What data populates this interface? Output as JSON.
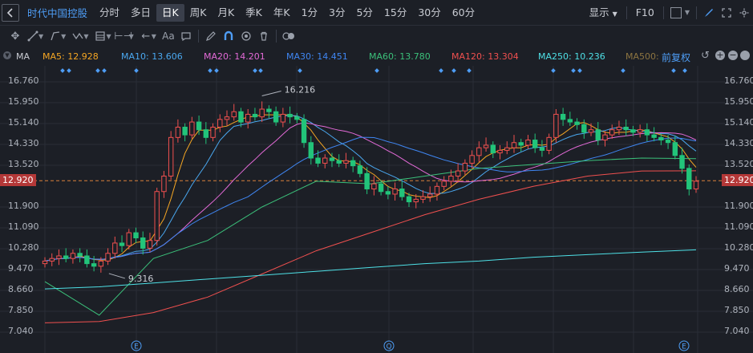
{
  "header": {
    "back_icon": "collapse-icon",
    "title": "时代中国控股",
    "periods": [
      "分时",
      "多日",
      "日K",
      "周K",
      "月K",
      "季K",
      "年K",
      "1分",
      "3分",
      "5分",
      "15分",
      "30分",
      "60分"
    ],
    "active_period": "日K",
    "display_label": "显示",
    "f10_label": "F10"
  },
  "ma": {
    "indicator": "MA",
    "items": [
      {
        "label": "MA5: 12.928",
        "color": "#f5a623"
      },
      {
        "label": "MA10: 13.606",
        "color": "#4aa8f0"
      },
      {
        "label": "MA20: 14.201",
        "color": "#e36ad7"
      },
      {
        "label": "MA30: 14.451",
        "color": "#3f86f2"
      },
      {
        "label": "MA60: 13.780",
        "color": "#3bc07a"
      },
      {
        "label": "MA120: 13.304",
        "color": "#f0504f"
      },
      {
        "label": "MA250: 10.236",
        "color": "#4ee0e6"
      },
      {
        "label": "MA500:",
        "color": "#8c7440"
      }
    ],
    "adjust_label": "前复权"
  },
  "axis": {
    "y_labels": [
      "16.760",
      "15.950",
      "15.140",
      "14.330",
      "13.520",
      "12.920",
      "11.900",
      "11.090",
      "10.280",
      "9.470",
      "8.660",
      "7.850",
      "7.040"
    ]
  },
  "chart_data": {
    "type": "candlestick",
    "current_price": 12.92,
    "annotations": [
      {
        "label": "16.216",
        "role": "high"
      },
      {
        "label": "9.316",
        "role": "low"
      }
    ],
    "ylim": [
      7.04,
      16.76
    ],
    "event_markers": [
      "E",
      "Q",
      "E"
    ],
    "ma_latest": {
      "MA5": 12.928,
      "MA10": 13.606,
      "MA20": 14.201,
      "MA30": 14.451,
      "MA60": 13.78,
      "MA120": 13.304,
      "MA250": 10.236
    },
    "candles_close": [
      9.8,
      9.9,
      10.0,
      9.9,
      10.1,
      10.0,
      9.7,
      9.6,
      9.8,
      10.1,
      10.5,
      10.4,
      10.9,
      10.7,
      10.3,
      10.6,
      12.5,
      13.1,
      14.6,
      15.0,
      14.7,
      15.2,
      14.9,
      14.6,
      15.0,
      15.3,
      15.4,
      15.6,
      15.2,
      15.5,
      15.4,
      15.7,
      15.6,
      15.2,
      15.5,
      15.4,
      15.3,
      14.4,
      13.8,
      13.6,
      13.8,
      13.7,
      13.6,
      13.7,
      13.5,
      13.2,
      12.6,
      12.8,
      12.5,
      12.4,
      12.6,
      12.3,
      12.1,
      12.2,
      12.3,
      12.4,
      12.7,
      12.9,
      13.1,
      13.3,
      13.6,
      13.9,
      14.2,
      14.3,
      14.0,
      14.1,
      14.2,
      14.4,
      14.3,
      14.5,
      14.2,
      14.1,
      14.6,
      15.5,
      15.3,
      15.2,
      15.1,
      14.8,
      14.9,
      14.5,
      14.7,
      14.9,
      15.0,
      14.9,
      14.8,
      14.9,
      14.7,
      14.6,
      14.5,
      14.4,
      13.9,
      13.4,
      12.6,
      12.9
    ]
  }
}
